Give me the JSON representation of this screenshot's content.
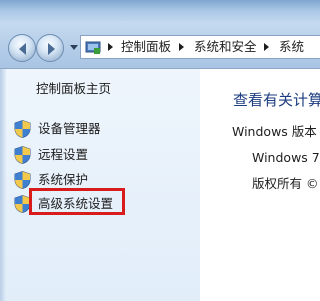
{
  "address_bar": {
    "breadcrumbs": [
      {
        "label": "控制面板"
      },
      {
        "label": "系统和安全"
      },
      {
        "label": "系统"
      }
    ]
  },
  "nav_pane": {
    "home_label": "控制面板主页",
    "items": [
      {
        "label": "设备管理器",
        "icon": "uac-shield-icon"
      },
      {
        "label": "远程设置",
        "icon": "uac-shield-icon"
      },
      {
        "label": "系统保护",
        "icon": "uac-shield-icon"
      },
      {
        "label": "高级系统设置",
        "icon": "uac-shield-icon",
        "highlighted": true
      }
    ]
  },
  "main": {
    "heading": "查看有关计算",
    "edition_label": "Windows 版本",
    "edition_value": "Windows 7",
    "copyright": "版权所有 ©"
  },
  "colors": {
    "heading": "#1c3d80",
    "highlight_border": "#d81c1c"
  }
}
